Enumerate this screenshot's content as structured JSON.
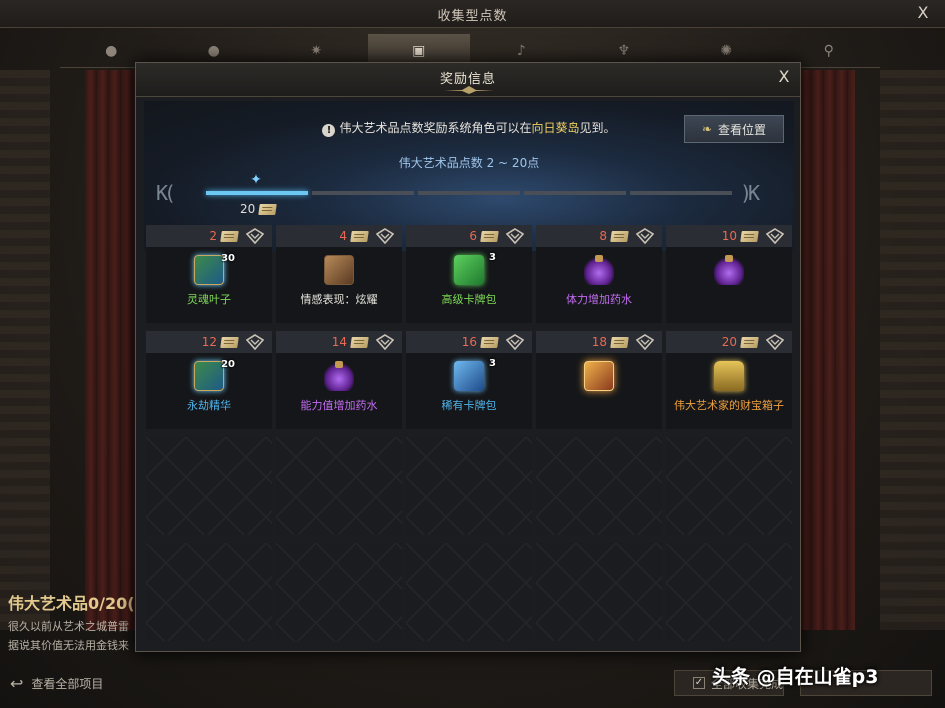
{
  "background": {
    "window_title": "收集型点数",
    "close_label": "X",
    "tabs": [
      {
        "icon": "ball-icon",
        "glyph": "●"
      },
      {
        "icon": "helmet-icon",
        "glyph": "●"
      },
      {
        "icon": "star-burst-icon",
        "glyph": "✷"
      },
      {
        "icon": "painting-icon",
        "glyph": "▣"
      },
      {
        "icon": "music-note-icon",
        "glyph": "♪"
      },
      {
        "icon": "crest-icon",
        "glyph": "♆"
      },
      {
        "icon": "maple-leaf-icon",
        "glyph": "✺"
      },
      {
        "icon": "telescope-icon",
        "glyph": "⚲"
      }
    ],
    "active_tab_index": 3,
    "info_title": "伟大艺术品0/20(",
    "info_line_1": "很久以前从艺术之城普雷",
    "info_line_2": "据说其价值无法用金钱来",
    "view_all_label": "查看全部项目",
    "check_button_label": "全部收集完成",
    "check_mark": "✓"
  },
  "dialog": {
    "title": "奖励信息",
    "close_label": "X",
    "notice_prefix": "伟大艺术品点数奖励系统角色可以在",
    "notice_highlight": "向日葵岛",
    "notice_suffix": "见到。",
    "warn_glyph": "!",
    "view_position_label": "查看位置",
    "range_label": "伟大艺术品点数 2 ~ 20点",
    "progress_value": "20",
    "progress_segments": 5,
    "progress_filled_segments": 1,
    "nav_first": "K(",
    "nav_last": ")K"
  },
  "rewards": [
    {
      "points": "2",
      "name": "灵魂叶子",
      "qty": "30",
      "icon": "ic-book-leaf",
      "color": "c-green"
    },
    {
      "points": "4",
      "name": "情感表现：炫耀",
      "qty": "",
      "icon": "ic-book-brown",
      "color": "c-white"
    },
    {
      "points": "6",
      "name": "高级卡牌包",
      "qty": "3",
      "icon": "ic-green-pack",
      "color": "c-green"
    },
    {
      "points": "8",
      "name": "体力增加药水",
      "qty": "",
      "icon": "ic-potion",
      "color": "c-purple"
    },
    {
      "points": "10",
      "name": "",
      "qty": "",
      "icon": "ic-potion",
      "color": "c-purple"
    },
    {
      "points": "12",
      "name": "永劫精华",
      "qty": "20",
      "icon": "ic-book-leaf",
      "color": "c-blue"
    },
    {
      "points": "14",
      "name": "能力值增加药水",
      "qty": "",
      "icon": "ic-potion",
      "color": "c-purple"
    },
    {
      "points": "16",
      "name": "稀有卡牌包",
      "qty": "3",
      "icon": "ic-blue-pack",
      "color": "c-blue"
    },
    {
      "points": "18",
      "name": "",
      "qty": "",
      "icon": "ic-gold-card",
      "color": "c-orange"
    },
    {
      "points": "20",
      "name": "伟大艺术家的财宝箱子",
      "qty": "",
      "icon": "ic-chest",
      "color": "c-orange"
    }
  ],
  "empty_slots": 10,
  "watermark": "头条 @自在山雀p3"
}
